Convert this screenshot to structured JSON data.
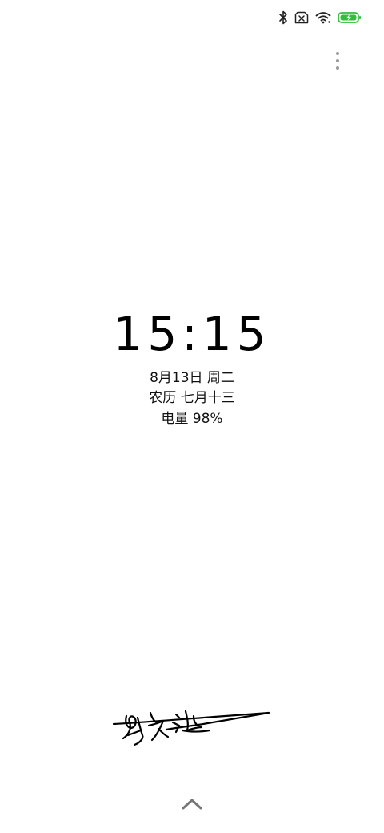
{
  "status_bar": {
    "icons": [
      "bluetooth-icon",
      "no-sim-icon",
      "wifi-icon",
      "battery-charging-icon"
    ],
    "battery_color": "#2fbf3a"
  },
  "menu": {
    "icon": "more-vertical-icon"
  },
  "lockscreen": {
    "time": "15:15",
    "date": "8月13日 周二",
    "lunar": "农历 七月十三",
    "battery": "电量 98%"
  },
  "signature": {
    "icon": "handwritten-signature"
  },
  "swipe": {
    "icon": "chevron-up-icon"
  }
}
